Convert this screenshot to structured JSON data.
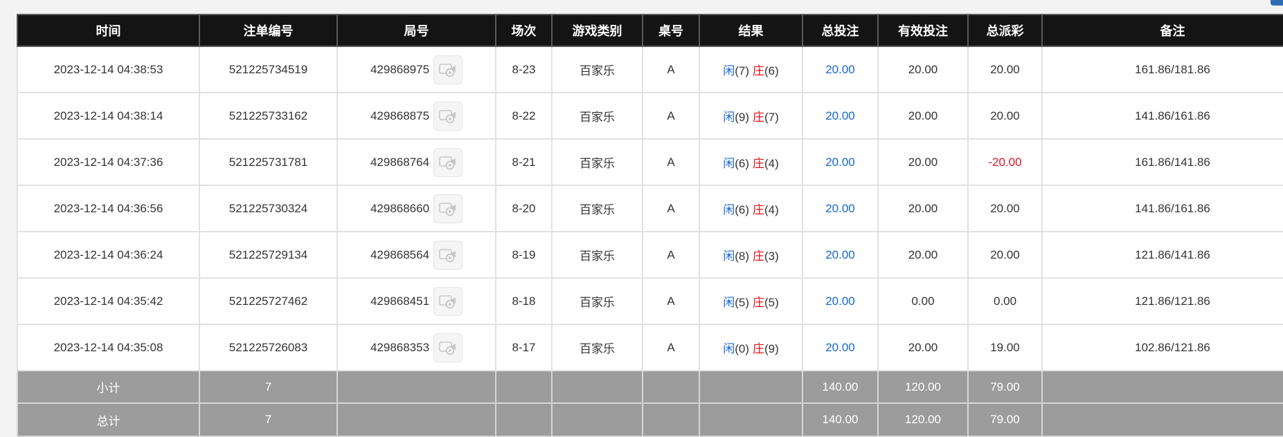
{
  "columns": [
    "时间",
    "注单编号",
    "局号",
    "场次",
    "游戏类别",
    "桌号",
    "结果",
    "总投注",
    "有效投注",
    "总派彩",
    "备注"
  ],
  "rows": [
    {
      "time": "2023-12-14 04:38:53",
      "order_no": "521225734519",
      "round_no": "429868975",
      "session": "8-23",
      "game": "百家乐",
      "table": "A",
      "player_label": "闲",
      "player_score": "(7)",
      "banker_label": "庄",
      "banker_score": "(6)",
      "total_bet": "20.00",
      "valid_bet": "20.00",
      "payout": "20.00",
      "payout_negative": false,
      "note": "161.86/181.86"
    },
    {
      "time": "2023-12-14 04:38:14",
      "order_no": "521225733162",
      "round_no": "429868875",
      "session": "8-22",
      "game": "百家乐",
      "table": "A",
      "player_label": "闲",
      "player_score": "(9)",
      "banker_label": "庄",
      "banker_score": "(7)",
      "total_bet": "20.00",
      "valid_bet": "20.00",
      "payout": "20.00",
      "payout_negative": false,
      "note": "141.86/161.86"
    },
    {
      "time": "2023-12-14 04:37:36",
      "order_no": "521225731781",
      "round_no": "429868764",
      "session": "8-21",
      "game": "百家乐",
      "table": "A",
      "player_label": "闲",
      "player_score": "(6)",
      "banker_label": "庄",
      "banker_score": "(4)",
      "total_bet": "20.00",
      "valid_bet": "20.00",
      "payout": "-20.00",
      "payout_negative": true,
      "note": "161.86/141.86"
    },
    {
      "time": "2023-12-14 04:36:56",
      "order_no": "521225730324",
      "round_no": "429868660",
      "session": "8-20",
      "game": "百家乐",
      "table": "A",
      "player_label": "闲",
      "player_score": "(6)",
      "banker_label": "庄",
      "banker_score": "(4)",
      "total_bet": "20.00",
      "valid_bet": "20.00",
      "payout": "20.00",
      "payout_negative": false,
      "note": "141.86/161.86"
    },
    {
      "time": "2023-12-14 04:36:24",
      "order_no": "521225729134",
      "round_no": "429868564",
      "session": "8-19",
      "game": "百家乐",
      "table": "A",
      "player_label": "闲",
      "player_score": "(8)",
      "banker_label": "庄",
      "banker_score": "(3)",
      "total_bet": "20.00",
      "valid_bet": "20.00",
      "payout": "20.00",
      "payout_negative": false,
      "note": "121.86/141.86"
    },
    {
      "time": "2023-12-14 04:35:42",
      "order_no": "521225727462",
      "round_no": "429868451",
      "session": "8-18",
      "game": "百家乐",
      "table": "A",
      "player_label": "闲",
      "player_score": "(5)",
      "banker_label": "庄",
      "banker_score": "(5)",
      "total_bet": "20.00",
      "valid_bet": "0.00",
      "payout": "0.00",
      "payout_negative": false,
      "note": "121.86/121.86"
    },
    {
      "time": "2023-12-14 04:35:08",
      "order_no": "521225726083",
      "round_no": "429868353",
      "session": "8-17",
      "game": "百家乐",
      "table": "A",
      "player_label": "闲",
      "player_score": "(0)",
      "banker_label": "庄",
      "banker_score": "(9)",
      "total_bet": "20.00",
      "valid_bet": "20.00",
      "payout": "19.00",
      "payout_negative": false,
      "note": "102.86/121.86"
    }
  ],
  "subtotal": {
    "label": "小计",
    "count": "7",
    "total_bet": "140.00",
    "valid_bet": "120.00",
    "payout": "79.00"
  },
  "total": {
    "label": "总计",
    "count": "7",
    "total_bet": "140.00",
    "valid_bet": "120.00",
    "payout": "79.00"
  },
  "icons": {
    "replay": "video-replay-icon"
  },
  "colors": {
    "header_bg": "#141414",
    "footer_bg": "#9c9c9c",
    "bet_blue": "#1565d8",
    "negative_red": "#e0141c",
    "corner_tab": "#2f6db3"
  }
}
